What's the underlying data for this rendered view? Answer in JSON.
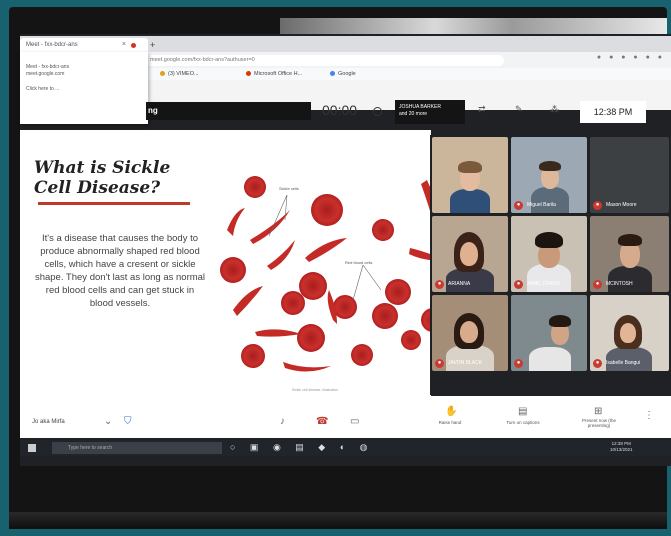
{
  "browser": {
    "tab_title": "Meet - fxx-bdcr-ans",
    "new_tab": "+",
    "url": "meet.google.com/fxx-bdcr-ans?authuser=0",
    "bookmarks": [
      "(3) VIMEO...",
      "Microsoft Office H...",
      "Google"
    ],
    "popup_lines": [
      "Meet - fxx-bdcr-ans",
      "meet.google.com",
      "",
      "Click here to ..."
    ]
  },
  "meet": {
    "dark_label": "ng",
    "timer": "00:00",
    "pinned_name": "JOSHUA BARKER",
    "pinned_sub": "and 20 more",
    "clock": "12:38 PM"
  },
  "slide": {
    "title_line1": "What is Sickle",
    "title_line2": "Cell Disease?",
    "body": "It's a disease that causes the body to produce abnormally shaped red blood cells, which have a cresent or sickle shape. They don't last as long as normal red blood cells and can get stuck in blood vessels.",
    "label_sickle": "Sickle cells",
    "label_red": "Red blood cells",
    "caption": "Sickle cell disease, illustration"
  },
  "participants": [
    {
      "name": ""
    },
    {
      "name": "Miguel Barila"
    },
    {
      "name": "Mason Moore",
      "initial": "M"
    },
    {
      "name": "ARIANNA"
    },
    {
      "name": "JAMIL TRAVIS"
    },
    {
      "name": "MCINTOSH"
    },
    {
      "name": "JAVON BLACK"
    },
    {
      "name": ""
    },
    {
      "name": "Isabelle Bangui"
    }
  ],
  "bottom_bar": {
    "mute_label": "Jo aka Mirfa",
    "raise_hand": "Raise hand",
    "captions": "Turn on captions",
    "present": "Present now (the presenting)"
  },
  "taskbar": {
    "search": "Type here to search",
    "time": "12:38 PM",
    "date": "10/13/2021"
  },
  "colors": {
    "screen_frame": "#17626e",
    "accent_red": "#c0392b",
    "mic_off": "#c93a32"
  }
}
